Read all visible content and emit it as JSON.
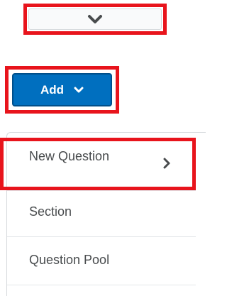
{
  "top_toggle": {
    "icon": "chevron-down-icon"
  },
  "add_button": {
    "label": "Add",
    "icon": "chevron-down-icon"
  },
  "menu": {
    "items": [
      {
        "label": "New Question",
        "icon": "chevron-right-icon"
      },
      {
        "label": "Section"
      },
      {
        "label": "Question Pool"
      }
    ]
  },
  "colors": {
    "highlight": "#e8141c",
    "primary_button": "#006fbf",
    "text": "#494c4e",
    "border": "#d6dadd"
  }
}
